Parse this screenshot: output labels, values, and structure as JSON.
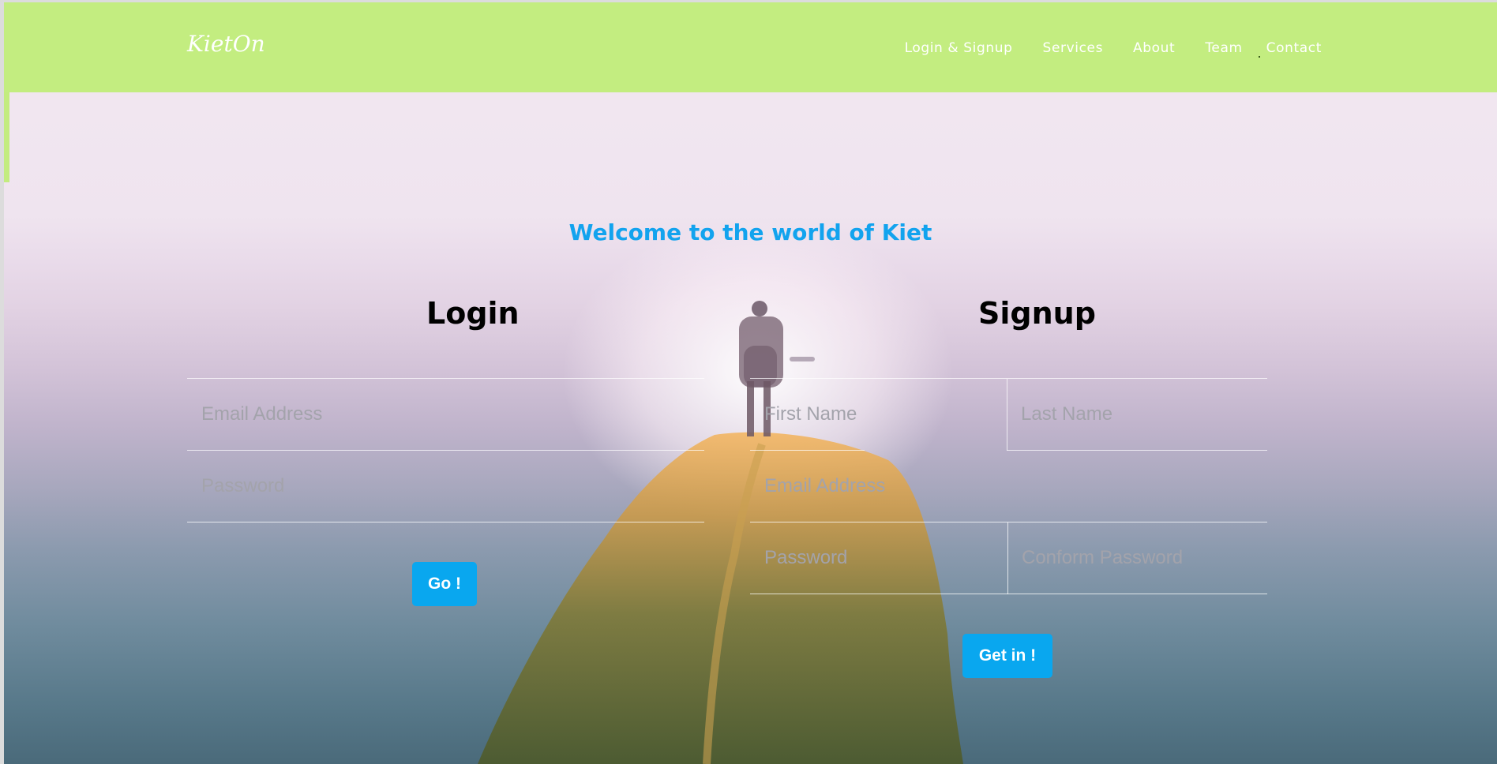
{
  "brand": "KietOn",
  "nav": {
    "items": [
      {
        "label": "Login & Signup"
      },
      {
        "label": "Services"
      },
      {
        "label": "About"
      },
      {
        "label": "Team"
      },
      {
        "label": "Contact"
      }
    ]
  },
  "welcome": "Welcome to the world of Kiet",
  "login": {
    "title": "Login",
    "email_placeholder": "Email Address",
    "password_placeholder": "Password",
    "button": "Go !"
  },
  "signup": {
    "title": "Signup",
    "first_name_placeholder": "First Name",
    "last_name_placeholder": "Last Name",
    "email_placeholder": "Email Address",
    "password_placeholder": "Password",
    "confirm_placeholder": "Conform Password",
    "button": "Get in !"
  },
  "colors": {
    "navbar": "#c3ed80",
    "accent": "#09a7ef"
  }
}
